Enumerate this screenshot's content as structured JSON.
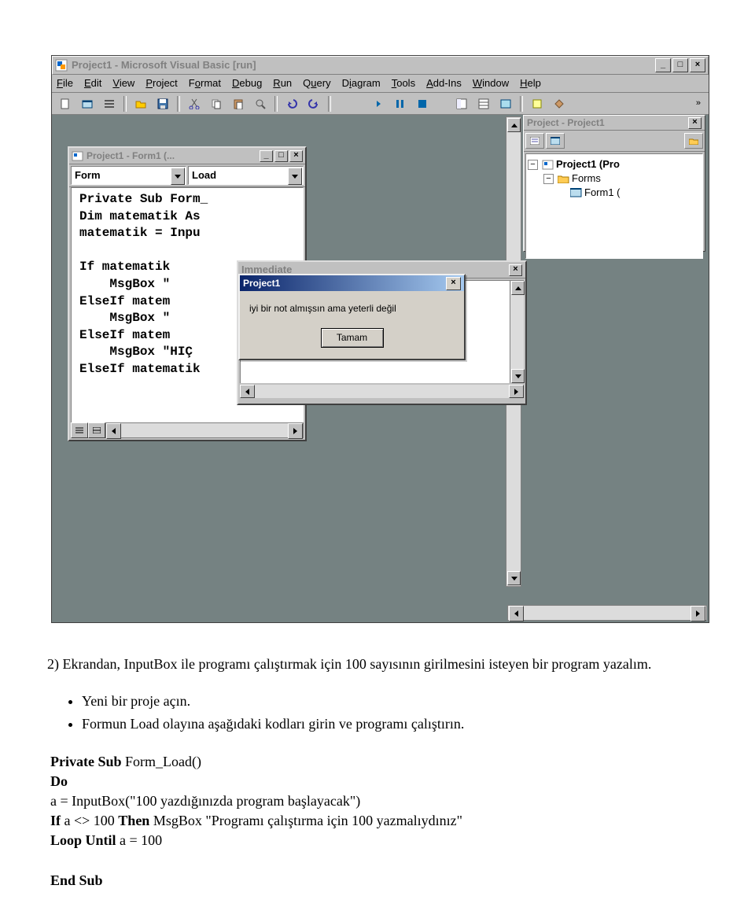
{
  "vb": {
    "title": "Project1 - Microsoft Visual Basic [run]",
    "menu": [
      "File",
      "Edit",
      "View",
      "Project",
      "Format",
      "Debug",
      "Run",
      "Query",
      "Diagram",
      "Tools",
      "Add-Ins",
      "Window",
      "Help"
    ],
    "project_panel": {
      "title": "Project - Project1",
      "tree": {
        "root": "Project1 (Pro",
        "folder": "Forms",
        "form": "Form1 ("
      }
    },
    "code_window": {
      "title": "Project1 - Form1 (...",
      "combo_left": "Form",
      "combo_right": "Load",
      "lines": [
        "Private Sub Form_",
        "Dim matematik As",
        "matematik = Inpu",
        "",
        "If matematik",
        "    MsgBox \"",
        "ElseIf matem",
        "    MsgBox \"",
        "ElseIf matem",
        "    MsgBox \"HIÇ",
        "ElseIf matematik"
      ]
    },
    "immediate_title": "Immediate",
    "msgbox": {
      "title": "Project1",
      "message": "iyi bir not almışsın ama yeterli değil",
      "ok": "Tamam"
    }
  },
  "doc": {
    "question": "2) Ekrandan, InputBox ile programı çalıştırmak için 100 sayısının girilmesini isteyen bir program yazalım.",
    "bullet1": "Yeni bir proje açın.",
    "bullet2": "Formun Load olayına aşağıdaki kodları girin ve programı çalıştırın.",
    "code": {
      "l1a": "Private Sub ",
      "l1b": "Form_Load()",
      "l2": "Do",
      "l3": "    a = InputBox(\"100 yazdığınızda program başlayacak\")",
      "l4a": "    If ",
      "l4b": "a <> 100 ",
      "l4c": "Then ",
      "l4d": "MsgBox \"Programı çalıştırma için 100 yazmalıydınız\"",
      "l5a": "Loop Until ",
      "l5b": "a = 100",
      "l7": "End Sub"
    }
  }
}
